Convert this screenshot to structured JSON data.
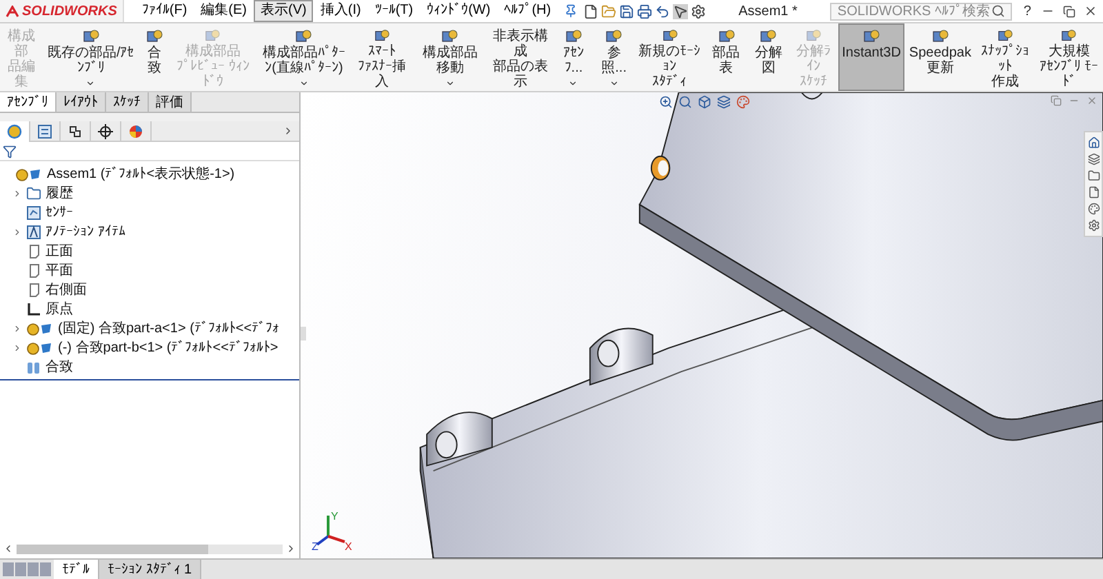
{
  "title_bar": {
    "logo": "SOLIDWORKS",
    "menu": [
      {
        "label": "ﾌｧｲﾙ(F)",
        "selected": false
      },
      {
        "label": "編集(E)",
        "selected": false
      },
      {
        "label": "表示(V)",
        "selected": true
      },
      {
        "label": "挿入(I)",
        "selected": false
      },
      {
        "label": "ﾂｰﾙ(T)",
        "selected": false
      },
      {
        "label": "ｳｨﾝﾄﾞｳ(W)",
        "selected": false
      },
      {
        "label": "ﾍﾙﾌﾟ(H)",
        "selected": false
      }
    ],
    "document_title": "Assem1 *",
    "help_search": {
      "placeholder": "SOLIDWORKS ﾍﾙﾌﾟ検索"
    },
    "help_button": "?"
  },
  "toolbar": [
    {
      "lines": [
        "構成部",
        "品編集"
      ],
      "disabled": true,
      "selected": false,
      "dropdown": false
    },
    {
      "lines": [
        "既存の部品/ｱｾﾝﾌﾞﾘ"
      ],
      "disabled": false,
      "selected": false,
      "dropdown": true
    },
    {
      "lines": [
        "合致"
      ],
      "disabled": false,
      "selected": false,
      "dropdown": false
    },
    {
      "lines": [
        "構成部品",
        "ﾌﾟﾚﾋﾞｭｰ ｳｨﾝﾄﾞｳ"
      ],
      "disabled": true,
      "selected": false,
      "dropdown": false
    },
    {
      "lines": [
        "構成部品ﾊﾟﾀｰﾝ(直線ﾊﾟﾀｰﾝ)"
      ],
      "disabled": false,
      "selected": false,
      "dropdown": true
    },
    {
      "lines": [
        "ｽﾏｰﾄ",
        "ﾌｧｽﾅｰ挿入"
      ],
      "disabled": false,
      "selected": false,
      "dropdown": false
    },
    {
      "lines": [
        "構成部品移動"
      ],
      "disabled": false,
      "selected": false,
      "dropdown": true
    },
    {
      "lines": [
        "非表示構成",
        "部品の表示"
      ],
      "disabled": false,
      "selected": false,
      "dropdown": false
    },
    {
      "lines": [
        "ｱｾﾝﾌ..."
      ],
      "disabled": false,
      "selected": false,
      "dropdown": true
    },
    {
      "lines": [
        "参照..."
      ],
      "disabled": false,
      "selected": false,
      "dropdown": true
    },
    {
      "lines": [
        "新規のﾓｰｼｮﾝ",
        "ｽﾀﾃﾞｨ"
      ],
      "disabled": false,
      "selected": false,
      "dropdown": false
    },
    {
      "lines": [
        "部品表"
      ],
      "disabled": false,
      "selected": false,
      "dropdown": false
    },
    {
      "lines": [
        "分解図"
      ],
      "disabled": false,
      "selected": false,
      "dropdown": false
    },
    {
      "lines": [
        "分解ﾗｲﾝ",
        "ｽｹｯﾁ"
      ],
      "disabled": true,
      "selected": false,
      "dropdown": false
    },
    {
      "lines": [
        "Instant3D"
      ],
      "disabled": false,
      "selected": true,
      "dropdown": false
    },
    {
      "lines": [
        "Speedpak",
        "更新"
      ],
      "disabled": false,
      "selected": false,
      "dropdown": false
    },
    {
      "lines": [
        "ｽﾅｯﾌﾟｼｮｯﾄ",
        "作成"
      ],
      "disabled": false,
      "selected": false,
      "dropdown": false
    },
    {
      "lines": [
        "大規模",
        "ｱｾﾝﾌﾞﾘ ﾓｰﾄﾞ"
      ],
      "disabled": false,
      "selected": false,
      "dropdown": false
    }
  ],
  "command_tabs": [
    {
      "label": "ｱｾﾝﾌﾞﾘ",
      "selected": true
    },
    {
      "label": "ﾚｲｱｳﾄ",
      "selected": false
    },
    {
      "label": "ｽｹｯﾁ",
      "selected": false
    },
    {
      "label": "評価",
      "selected": false
    }
  ],
  "panel_tabs": [
    {
      "kind": "tree",
      "selected": true
    },
    {
      "kind": "properties",
      "selected": false
    },
    {
      "kind": "config",
      "selected": false
    },
    {
      "kind": "dimxpert",
      "selected": false
    },
    {
      "kind": "display",
      "selected": false
    }
  ],
  "feature_tree": [
    {
      "kind": "assembly",
      "label": "Assem1 (ﾃﾞﾌｫﾙﾄ<表示状態-1>)",
      "expanded": true,
      "children": [
        {
          "kind": "history",
          "label": "履歴",
          "expanded": false
        },
        {
          "kind": "sensor",
          "label": "ｾﾝｻｰ"
        },
        {
          "kind": "annotation",
          "label": "ｱﾉﾃｰｼｮﾝ ｱｲﾃﾑ",
          "expanded": false
        },
        {
          "kind": "plane",
          "label": "正面"
        },
        {
          "kind": "plane",
          "label": "平面"
        },
        {
          "kind": "plane",
          "label": "右側面"
        },
        {
          "kind": "origin",
          "label": "原点"
        },
        {
          "kind": "part",
          "label": "(固定) 合致part-a<1> (ﾃﾞﾌｫﾙﾄ<<ﾃﾞﾌｫ",
          "expanded": false
        },
        {
          "kind": "part",
          "label": "(-) 合致part-b<1> (ﾃﾞﾌｫﾙﾄ<<ﾃﾞﾌｫﾙﾄ>",
          "expanded": false
        },
        {
          "kind": "mates",
          "label": "合致"
        }
      ]
    }
  ],
  "triad": [
    "Y",
    "Z",
    "X"
  ],
  "bottom_tabs": [
    {
      "label": "ﾓﾃﾞﾙ",
      "selected": true
    },
    {
      "label": "ﾓｰｼｮﾝ ｽﾀﾃﾞｨ 1",
      "selected": false
    }
  ]
}
